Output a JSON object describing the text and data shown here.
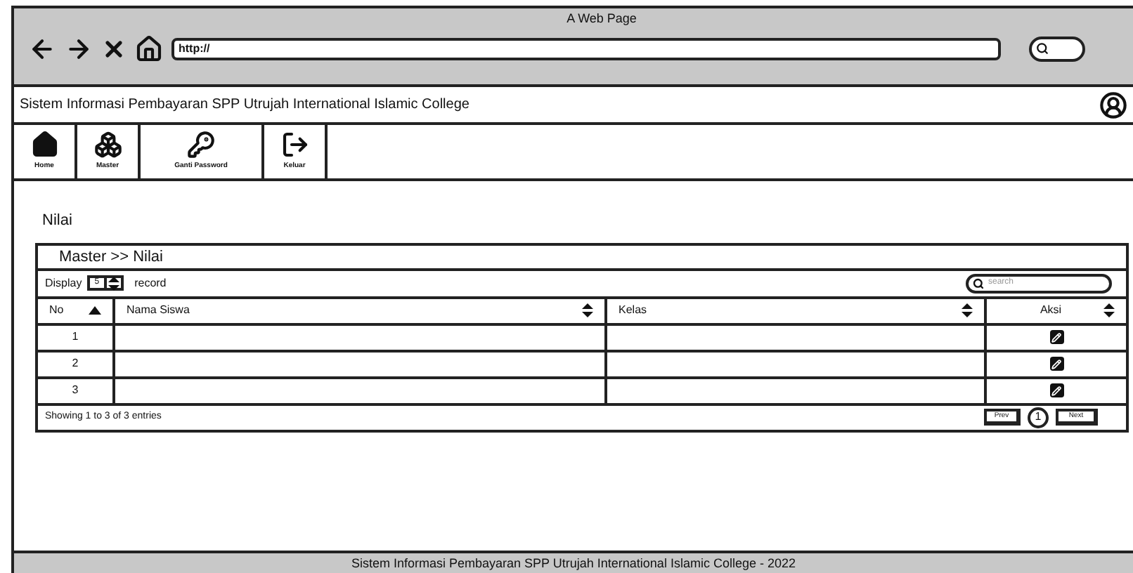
{
  "window": {
    "title": "A Web Page",
    "url": "http://"
  },
  "header": {
    "title": "Sistem Informasi Pembayaran SPP Utrujah International Islamic College"
  },
  "nav": [
    {
      "label": "Home",
      "kind": "home"
    },
    {
      "label": "Master",
      "kind": "master"
    },
    {
      "label": "Ganti Password",
      "kind": "key"
    },
    {
      "label": "Keluar",
      "kind": "exit"
    }
  ],
  "page_title": "Nilai",
  "panel": {
    "breadcrumb": "Master >> Nilai",
    "display_label": "Display",
    "display_value": "5",
    "record_label": "record",
    "search": {
      "placeholder": "search"
    }
  },
  "table": {
    "columns": [
      {
        "label": "No",
        "sorted": true
      },
      {
        "label": "Nama Siswa",
        "sorted": false
      },
      {
        "label": "Kelas",
        "sorted": false
      },
      {
        "label": "Aksi",
        "sorted": false
      }
    ],
    "rows": [
      {
        "no": "1"
      },
      {
        "no": "2"
      },
      {
        "no": "3"
      }
    ]
  },
  "info": "Showing 1 to 3 of 3 entries",
  "pagination": {
    "prev": "Prev",
    "page": "1",
    "next": "Next"
  },
  "footer": "Sistem Informasi Pembayaran SPP Utrujah International Islamic College - 2022"
}
